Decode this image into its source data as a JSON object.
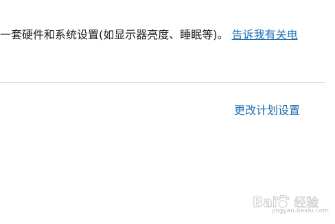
{
  "description": {
    "text": "一套硬件和系统设置(如显示器亮度、睡眠等)。",
    "link_text": "告诉我有关电"
  },
  "change_plan_link": "更改计划设置",
  "watermark": {
    "logo_text": "Baidu 经验",
    "sub_text": "jingyan.baidu.com"
  },
  "colors": {
    "link": "#1f6fb3",
    "text": "#1a1a1a",
    "divider": "#cccccc"
  }
}
